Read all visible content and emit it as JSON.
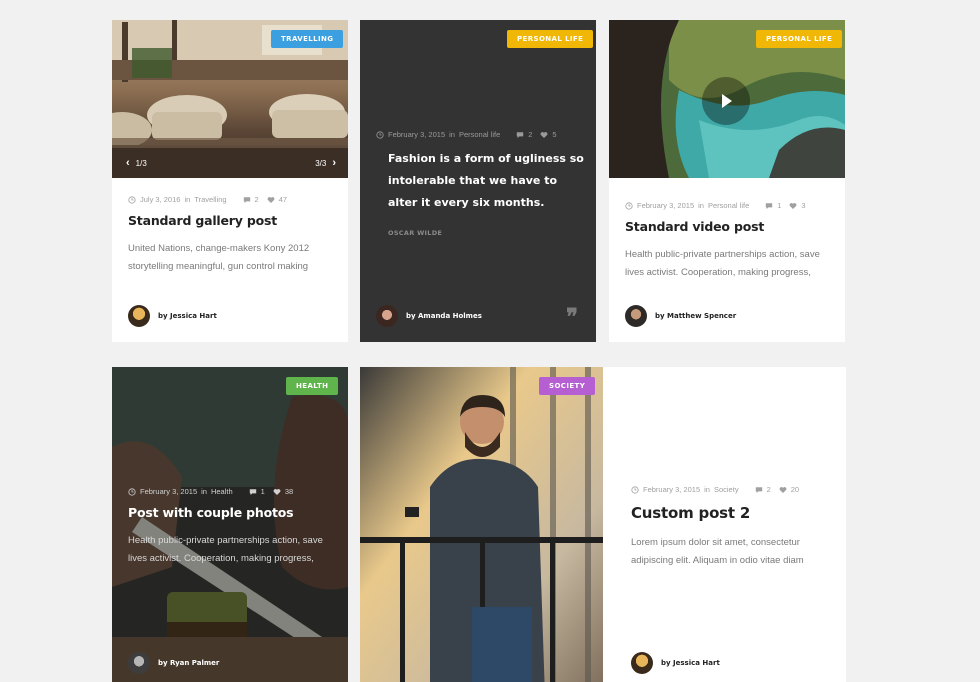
{
  "colors": {
    "travelling": "#3b9fe0",
    "personal": "#f1b706",
    "health": "#5fb44b",
    "society": "#b65fd3",
    "dark": "#333333"
  },
  "posts": [
    {
      "category": "TRAVELLING",
      "date": "July 3, 2016",
      "in": "in",
      "cat_name": "Travelling",
      "comments": "2",
      "likes": "47",
      "title": "Standard gallery post",
      "excerpt": "United Nations, change-makers Kony 2012 storytelling meaningful, gun control making",
      "author": "by Jessica Hart",
      "gallery_left": "1/3",
      "gallery_right": "3/3"
    },
    {
      "category": "PERSONAL LIFE",
      "date": "February 3, 2015",
      "in": "in",
      "cat_name": "Personal life",
      "comments": "2",
      "likes": "5",
      "quote": "Fashion is a form of ugliness so intolerable that we have to alter it every six months.",
      "quote_author": "OSCAR WILDE",
      "author": "by Amanda Holmes"
    },
    {
      "category": "PERSONAL LIFE",
      "date": "February 3, 2015",
      "in": "in",
      "cat_name": "Personal life",
      "comments": "1",
      "likes": "3",
      "title": "Standard video post",
      "excerpt": "Health public-private partnerships action, save lives activist. Cooperation, making progress,",
      "author": "by Matthew Spencer"
    },
    {
      "category": "HEALTH",
      "date": "February 3, 2015",
      "in": "in",
      "cat_name": "Health",
      "comments": "1",
      "likes": "38",
      "title": "Post with couple photos",
      "excerpt": "Health public-private partnerships action, save lives activist. Cooperation, making progress,",
      "author": "by Ryan Palmer"
    },
    {
      "category": "SOCIETY",
      "date": "February 3, 2015",
      "in": "in",
      "cat_name": "Society",
      "comments": "2",
      "likes": "20",
      "title": "Custom post 2",
      "excerpt": "Lorem ipsum dolor sit amet, consectetur adipiscing elit. Aliquam in odio vitae diam",
      "author": "by Jessica Hart"
    }
  ],
  "icons": [
    "clock-icon",
    "comment-icon",
    "heart-icon",
    "play-icon",
    "quote-icon",
    "chevron-left-icon",
    "chevron-right-icon"
  ]
}
